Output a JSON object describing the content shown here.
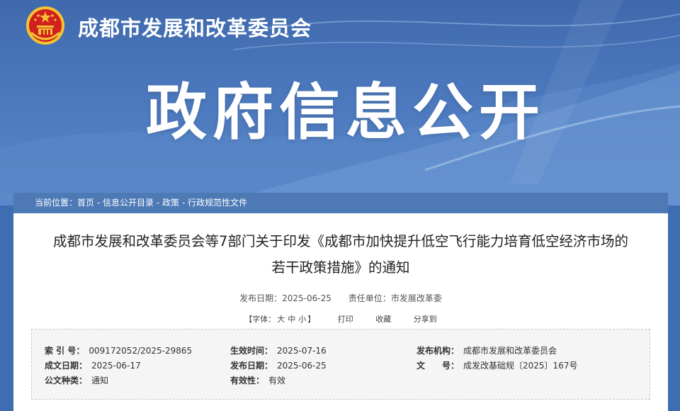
{
  "header": {
    "org_name": "成都市发展和改革委员会",
    "banner_title": "政府信息公开"
  },
  "breadcrumb": {
    "prefix": "当前位置：",
    "items": [
      "首页",
      "信息公开目录",
      "政策",
      "行政规范性文件"
    ],
    "separator": " - "
  },
  "document": {
    "title_line1": "成都市发展和改革委员会等7部门关于印发《成都市加快提升低空飞行能力培育低空经济市场的",
    "title_line2": "若干政策措施》的通知",
    "publish_date_label": "发布日期：",
    "publish_date": "2025-06-25",
    "owner_label": "责任单位：",
    "owner": "市发展改革委"
  },
  "tools": {
    "font_label": "【字体：",
    "font_large": "大",
    "font_medium": "中",
    "font_small": "小",
    "font_close": "】",
    "print": "打印",
    "favorite": "收藏",
    "share": "分享到"
  },
  "info": {
    "index_label": "索 引 号：",
    "index_value": "009172052/2025-29865",
    "effective_label": "生效时间：",
    "effective_value": "2025-07-16",
    "issuer_label": "发布机构：",
    "issuer_value": "成都市发展和改革委员会",
    "written_label": "成文日期：",
    "written_value": "2025-06-17",
    "publish_label": "发布日期：",
    "publish_value": "2025-06-25",
    "docno_label": "文　　号：",
    "docno_value": "成发改基础规〔2025〕167号",
    "type_label": "公文种类：",
    "type_value": "通知",
    "validity_label": "有效性：",
    "validity_value": "有效"
  },
  "colors": {
    "banner": "#4673b8",
    "breadcrumb_bar": "#4d79b5",
    "emblem_red": "#d21f1f",
    "emblem_gold": "#f4c430"
  }
}
